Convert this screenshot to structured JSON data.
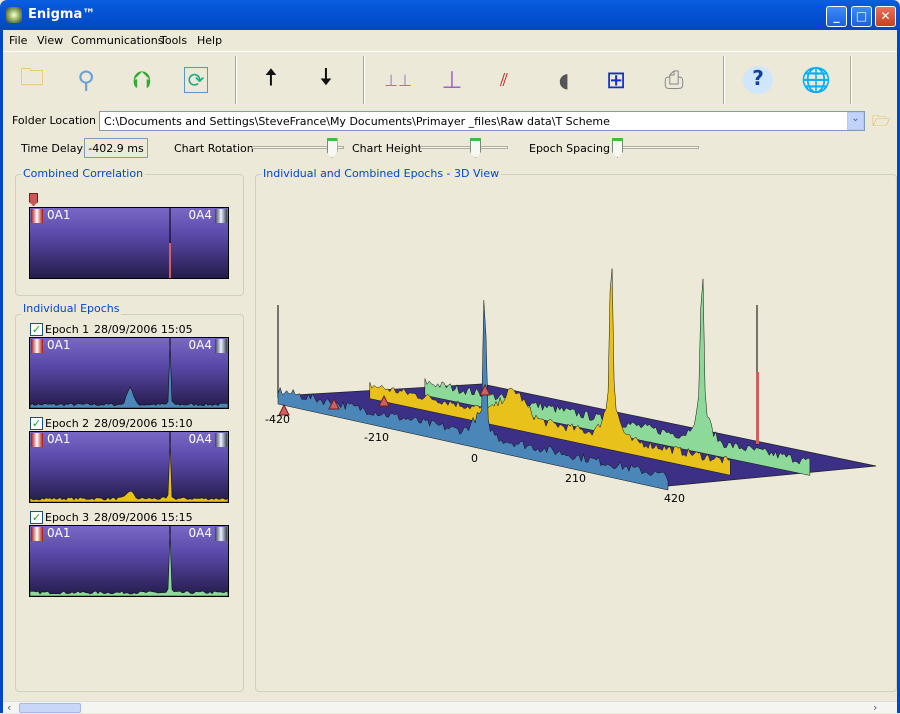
{
  "window": {
    "title": "Enigma™",
    "minimize": "_",
    "maximize": "□",
    "close": "✕"
  },
  "menu": [
    "File",
    "View",
    "Communications",
    "Tools",
    "Help"
  ],
  "toolbar": [
    {
      "icon": "open-folder-icon",
      "label": "Open"
    },
    {
      "icon": "search-icon",
      "label": "Find"
    },
    {
      "icon": "folder-export-icon",
      "label": "Export"
    },
    {
      "icon": "refresh-icon",
      "label": "Refresh"
    },
    {
      "icon": "upload-epochs-icon",
      "label": "Upload"
    },
    {
      "icon": "download-epochs-icon",
      "label": "Download"
    },
    {
      "icon": "multi-chart-icon",
      "label": "Multi"
    },
    {
      "icon": "single-chart-icon",
      "label": "Single"
    },
    {
      "icon": "3d-chart-icon",
      "label": "3D"
    },
    {
      "icon": "speaker-icon",
      "label": "Sound"
    },
    {
      "icon": "network-icon",
      "label": "Network"
    },
    {
      "icon": "printer-icon",
      "label": "Print"
    },
    {
      "icon": "help-icon",
      "label": "Help"
    },
    {
      "icon": "web-globe-icon",
      "label": "Web"
    }
  ],
  "folder": {
    "label": "Folder Location",
    "value": "C:\\Documents and Settings\\SteveFrance\\My Documents\\Primayer _files\\Raw data\\T Scheme"
  },
  "controls": {
    "time_delay_label": "Time Delay",
    "time_delay_value": "-402.9 ms",
    "rotation_label": "Chart Rotation",
    "rotation_level": 0.92,
    "height_label": "Chart Height",
    "height_level": 0.65,
    "spacing_label": "Epoch Spacing",
    "spacing_level": 0.0
  },
  "combined": {
    "title": "Combined Correlation",
    "left_sensor": "0A1",
    "right_sensor": "0A4"
  },
  "epochs_group": {
    "title": "Individual Epochs"
  },
  "epochs": [
    {
      "name": "Epoch 1",
      "timestamp": "28/09/2006 15:05",
      "checked": true,
      "left_sensor": "0A1",
      "right_sensor": "0A4",
      "color": "#4a86b8"
    },
    {
      "name": "Epoch 2",
      "timestamp": "28/09/2006 15:10",
      "checked": true,
      "left_sensor": "0A1",
      "right_sensor": "0A4",
      "color": "#e8c21a"
    },
    {
      "name": "Epoch 3",
      "timestamp": "28/09/2006 15:15",
      "checked": true,
      "left_sensor": "0A1",
      "right_sensor": "0A4",
      "color": "#8cd99a"
    }
  ],
  "view3d": {
    "title": "Individual and Combined Epochs - 3D View",
    "ticks": [
      "-420",
      "-210",
      "0",
      "210",
      "420"
    ],
    "combined_color": "#d06060",
    "plane_color": "#3c2f86"
  },
  "scroll": {
    "left": "‹",
    "right": "›"
  }
}
